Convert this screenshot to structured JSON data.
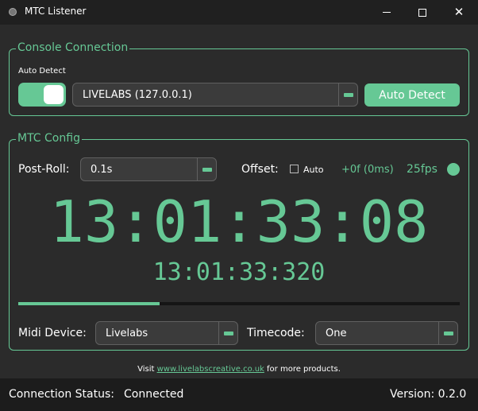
{
  "window": {
    "title": "MTC Listener",
    "minimize": "—",
    "maximize": "☐",
    "close": "✕"
  },
  "connection": {
    "group_title": "Console Connection",
    "auto_detect_label": "Auto Detect",
    "auto_detect_enabled": true,
    "console_selected": "LIVELABS (127.0.0.1)",
    "auto_detect_button": "Auto Detect"
  },
  "mtc": {
    "group_title": "MTC Config",
    "post_roll_label": "Post-Roll:",
    "post_roll_value": "0.1s",
    "offset_label": "Offset:",
    "offset_auto_label": "Auto",
    "offset_auto_checked": false,
    "offset_value": "+0f (0ms)",
    "fps": "25fps",
    "timecode_frames": "13:01:33:08",
    "timecode_ms": "13:01:33:320",
    "progress_fraction": 0.32,
    "midi_device_label": "Midi Device:",
    "midi_device_value": "Livelabs",
    "timecode_label": "Timecode:",
    "timecode_value": "One"
  },
  "footer": {
    "prefix": "Visit ",
    "link": "www.livelabscreative.co.uk",
    "suffix": " for more products."
  },
  "status": {
    "connection_label": "Connection Status:",
    "connection_value": "Connected",
    "version_label": "Version: 0.2.0"
  },
  "colors": {
    "accent": "#66c895",
    "background": "#2b2b2b",
    "titlebar": "#202020"
  }
}
